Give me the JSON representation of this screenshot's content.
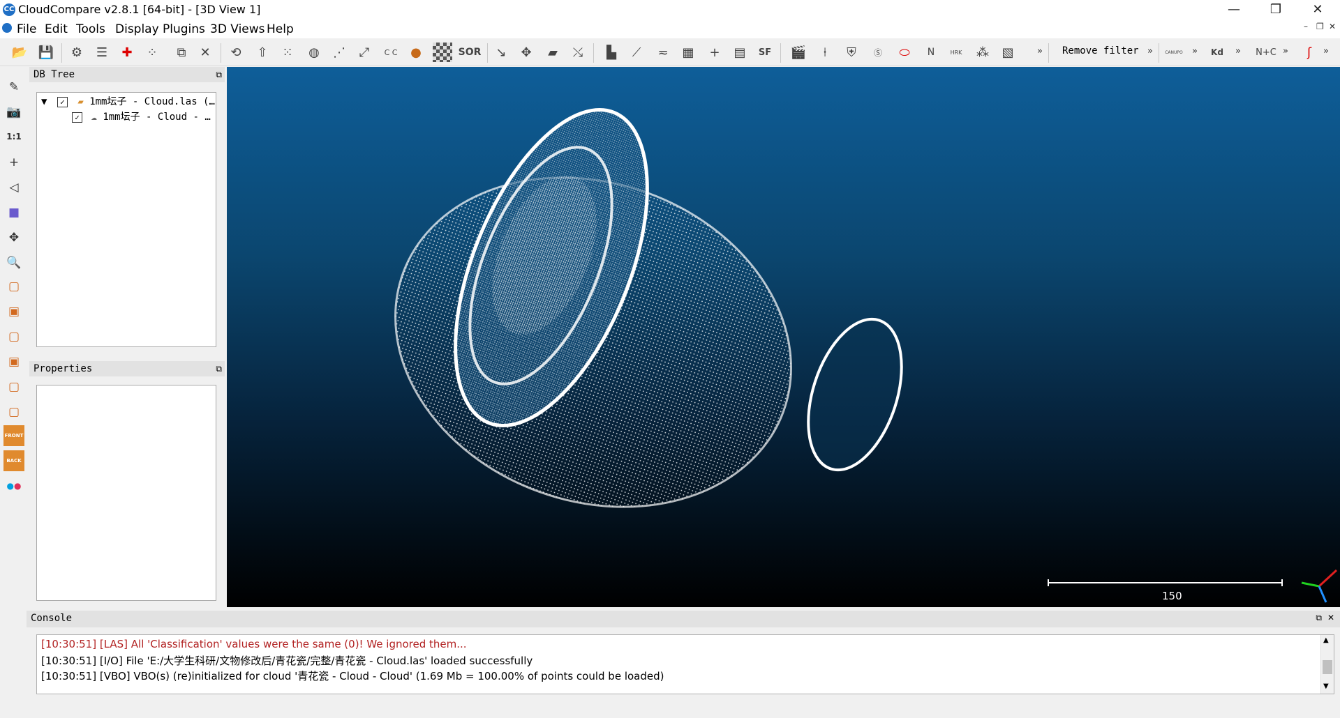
{
  "window": {
    "title": "CloudCompare v2.8.1 [64-bit] - [3D View 1]",
    "app_icon_text": "CC",
    "minimize": "—",
    "restore": "❐",
    "close": "✕"
  },
  "menu": {
    "items": [
      "File",
      "Edit",
      "Tools",
      "Display",
      "Plugins",
      "3D Views",
      "Help"
    ]
  },
  "toolbar": {
    "remove_filter_label": "Remove filter",
    "sor_label": "SOR",
    "sf_label": "SF",
    "chevron": "»",
    "kd_label": "Kd",
    "nc_label": "N+C",
    "canupo_label": "CANUPO",
    "n_label": "N",
    "hrk_label": "HRK"
  },
  "left_toolbar": {
    "one_to_one": "1:1",
    "front_label": "FRONT",
    "back_label": "BACK"
  },
  "db_tree": {
    "title": "DB Tree",
    "items": [
      {
        "label": "1mm坛子 - Cloud.las (…",
        "checked": true,
        "type": "folder"
      },
      {
        "label": "1mm坛子 - Cloud - …",
        "checked": true,
        "type": "cloud"
      }
    ]
  },
  "properties": {
    "title": "Properties"
  },
  "view3d": {
    "scale_value": "150",
    "background_top": "#0e5e99",
    "background_bottom": "#000000"
  },
  "console": {
    "title": "Console",
    "lines": [
      {
        "text": "[10:30:51] [LAS] All 'Classification' values were the same (0)! We ignored them...",
        "color": "#b22222"
      },
      {
        "text": "[10:30:51] [I/O] File 'E:/大学生科研/文物修改后/青花瓷/完整/青花瓷 - Cloud.las' loaded successfully",
        "color": "#000000"
      },
      {
        "text": "[10:30:51] [VBO] VBO(s) (re)initialized for cloud '青花瓷 - Cloud - Cloud' (1.69 Mb = 100.00% of points could be loaded)",
        "color": "#000000"
      }
    ]
  }
}
